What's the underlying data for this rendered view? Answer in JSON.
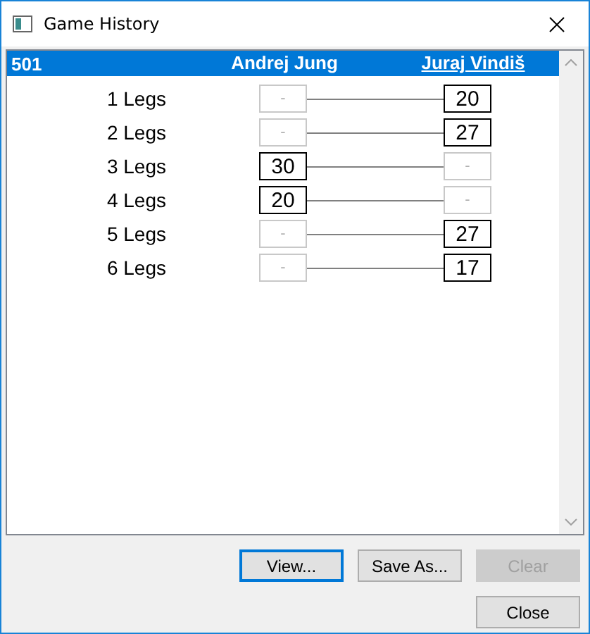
{
  "window": {
    "title": "Game History"
  },
  "header": {
    "game": "501",
    "players": [
      {
        "name": "Andrej Jung",
        "winner": false
      },
      {
        "name": "Juraj Vindiš",
        "winner": true
      }
    ],
    "selected": true
  },
  "legs": [
    {
      "label": "1 Legs",
      "scores": [
        {
          "text": "-",
          "active": false
        },
        {
          "text": "20",
          "active": true
        }
      ]
    },
    {
      "label": "2 Legs",
      "scores": [
        {
          "text": "-",
          "active": false
        },
        {
          "text": "27",
          "active": true
        }
      ]
    },
    {
      "label": "3 Legs",
      "scores": [
        {
          "text": "30",
          "active": true
        },
        {
          "text": "-",
          "active": false
        }
      ]
    },
    {
      "label": "4 Legs",
      "scores": [
        {
          "text": "20",
          "active": true
        },
        {
          "text": "-",
          "active": false
        }
      ]
    },
    {
      "label": "5 Legs",
      "scores": [
        {
          "text": "-",
          "active": false
        },
        {
          "text": "27",
          "active": true
        }
      ]
    },
    {
      "label": "6 Legs",
      "scores": [
        {
          "text": "-",
          "active": false
        },
        {
          "text": "17",
          "active": true
        }
      ]
    }
  ],
  "buttons": [
    {
      "label": "View...",
      "disabled": false,
      "default": true
    },
    {
      "label": "Save As...",
      "disabled": false,
      "default": false
    },
    {
      "label": "Clear",
      "disabled": true,
      "default": false
    }
  ],
  "close_button": {
    "label": "Close",
    "disabled": false
  }
}
